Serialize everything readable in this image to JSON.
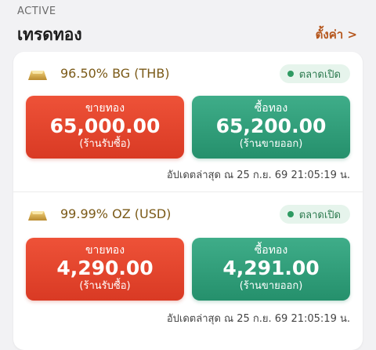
{
  "header": {
    "section_label": "ACTIVE",
    "title": "เทรดทอง",
    "settings_link": "ตั้งค่า >"
  },
  "products": [
    {
      "name": "96.50% BG (THB)",
      "status": "ตลาดเปิด",
      "sell": {
        "label": "ขายทอง",
        "price": "65,000.00",
        "sub": "(ร้านรับซื้อ)"
      },
      "buy": {
        "label": "ซื้อทอง",
        "price": "65,200.00",
        "sub": "(ร้านขายออก)"
      },
      "updated": "อัปเดตล่าสุด ณ 25 ก.ย. 69 21:05:19 น."
    },
    {
      "name": "99.99% OZ (USD)",
      "status": "ตลาดเปิด",
      "sell": {
        "label": "ขายทอง",
        "price": "4,290.00",
        "sub": "(ร้านรับซื้อ)"
      },
      "buy": {
        "label": "ซื้อทอง",
        "price": "4,291.00",
        "sub": "(ร้านขายออก)"
      },
      "updated": "อัปเดตล่าสุด ณ 25 ก.ย. 69 21:05:19 น."
    }
  ],
  "colors": {
    "sell": "#e2452e",
    "buy": "#2f9f7a",
    "gold": "#c9a24a",
    "status_green": "#2e9a62",
    "accent": "#b5561c"
  }
}
